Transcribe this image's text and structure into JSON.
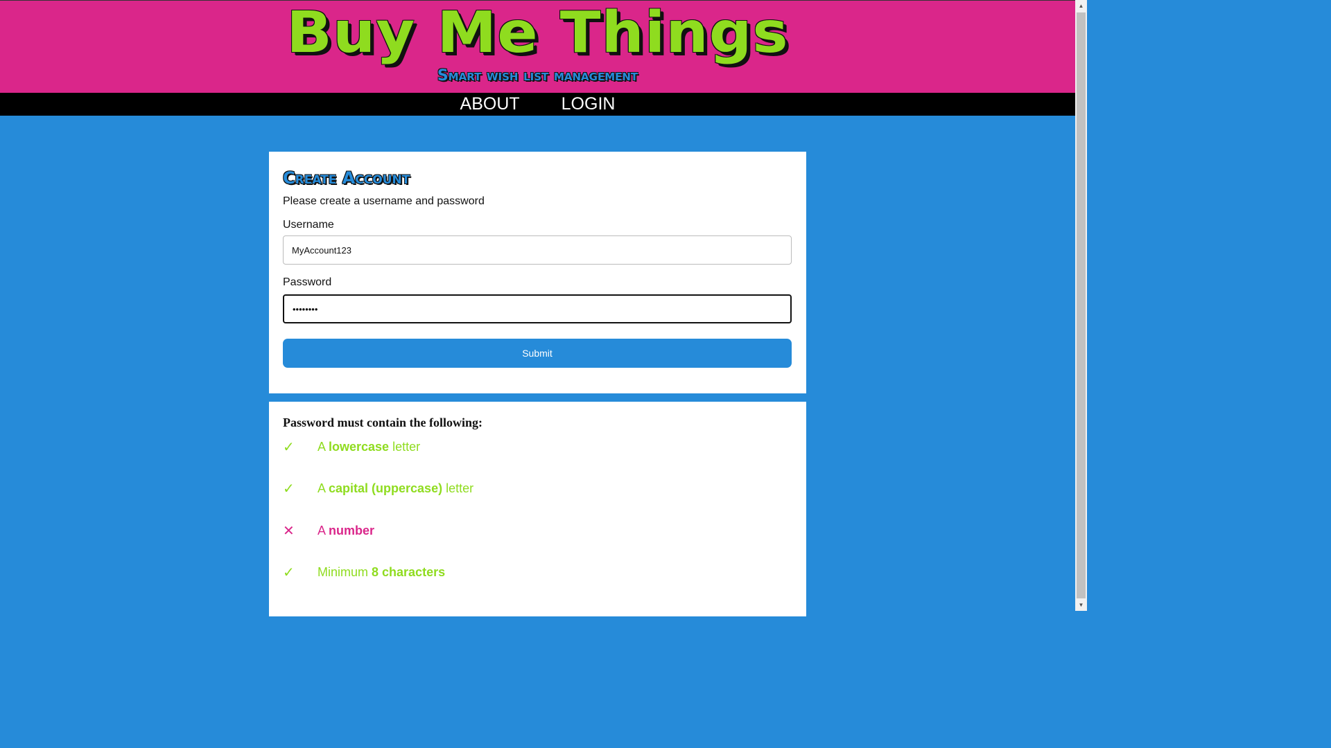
{
  "header": {
    "title": "Buy Me Things",
    "subtitle": "Smart wish list management"
  },
  "nav": {
    "items": [
      {
        "label": "ABOUT"
      },
      {
        "label": "LOGIN"
      }
    ]
  },
  "form": {
    "title": "Create Account",
    "description": "Please create a username and password",
    "username_label": "Username",
    "username_value": "MyAccount123",
    "password_label": "Password",
    "password_value": "••••••••",
    "submit_label": "Submit"
  },
  "password_rules": {
    "heading": "Password must contain the following:",
    "items": [
      {
        "status": "valid",
        "mark": "✓",
        "prefix": "A ",
        "emphasis": "lowercase",
        "suffix": " letter"
      },
      {
        "status": "valid",
        "mark": "✓",
        "prefix": "A ",
        "emphasis": "capital (uppercase)",
        "suffix": " letter"
      },
      {
        "status": "invalid",
        "mark": "✕",
        "prefix": "A ",
        "emphasis": "number",
        "suffix": ""
      },
      {
        "status": "valid",
        "mark": "✓",
        "prefix": "Minimum ",
        "emphasis": "8 characters",
        "suffix": ""
      }
    ]
  },
  "colors": {
    "brand_pink": "#da268a",
    "brand_green": "#8fdc1f",
    "brand_blue": "#268bd9",
    "nav_background": "#000000"
  },
  "scrollbar": {
    "up_icon": "scroll-up-arrow-icon",
    "down_icon": "scroll-down-arrow-icon"
  }
}
